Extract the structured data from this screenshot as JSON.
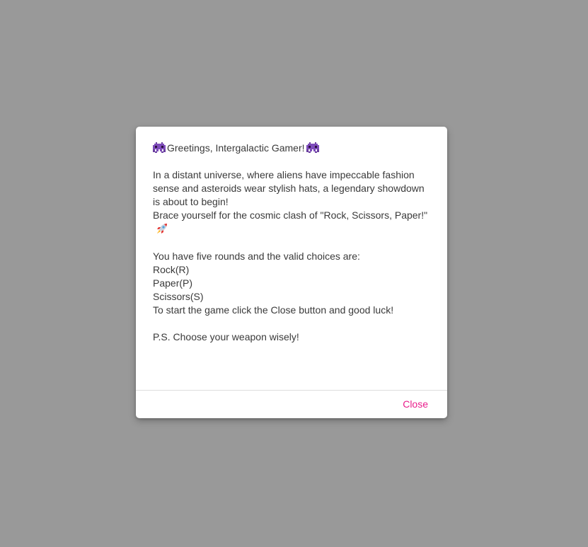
{
  "dialog": {
    "greeting": "Greetings, Intergalactic Gamer!",
    "intro_paragraph": "In a distant universe, where aliens have impeccable fashion sense and asteroids wear stylish hats, a legendary showdown is about to begin!",
    "brace_line": "Brace yourself for the cosmic clash of \"Rock, Scissors, Paper!\"",
    "rounds_line": "You have five rounds and the valid choices are:",
    "choices": [
      "Rock(R)",
      "Paper(P)",
      "Scissors(S)"
    ],
    "start_line": "To start the game click the Close button and good luck!",
    "ps_line": "P.S. Choose your weapon wisely!",
    "close_label": "Close",
    "icons": {
      "greeting_left": "alien-monster-icon",
      "greeting_right": "alien-monster-icon",
      "brace_end": "rocket-icon"
    },
    "colors": {
      "accent": "#e91e8c",
      "backdrop": "#999999",
      "text": "#3a3a3a"
    }
  }
}
